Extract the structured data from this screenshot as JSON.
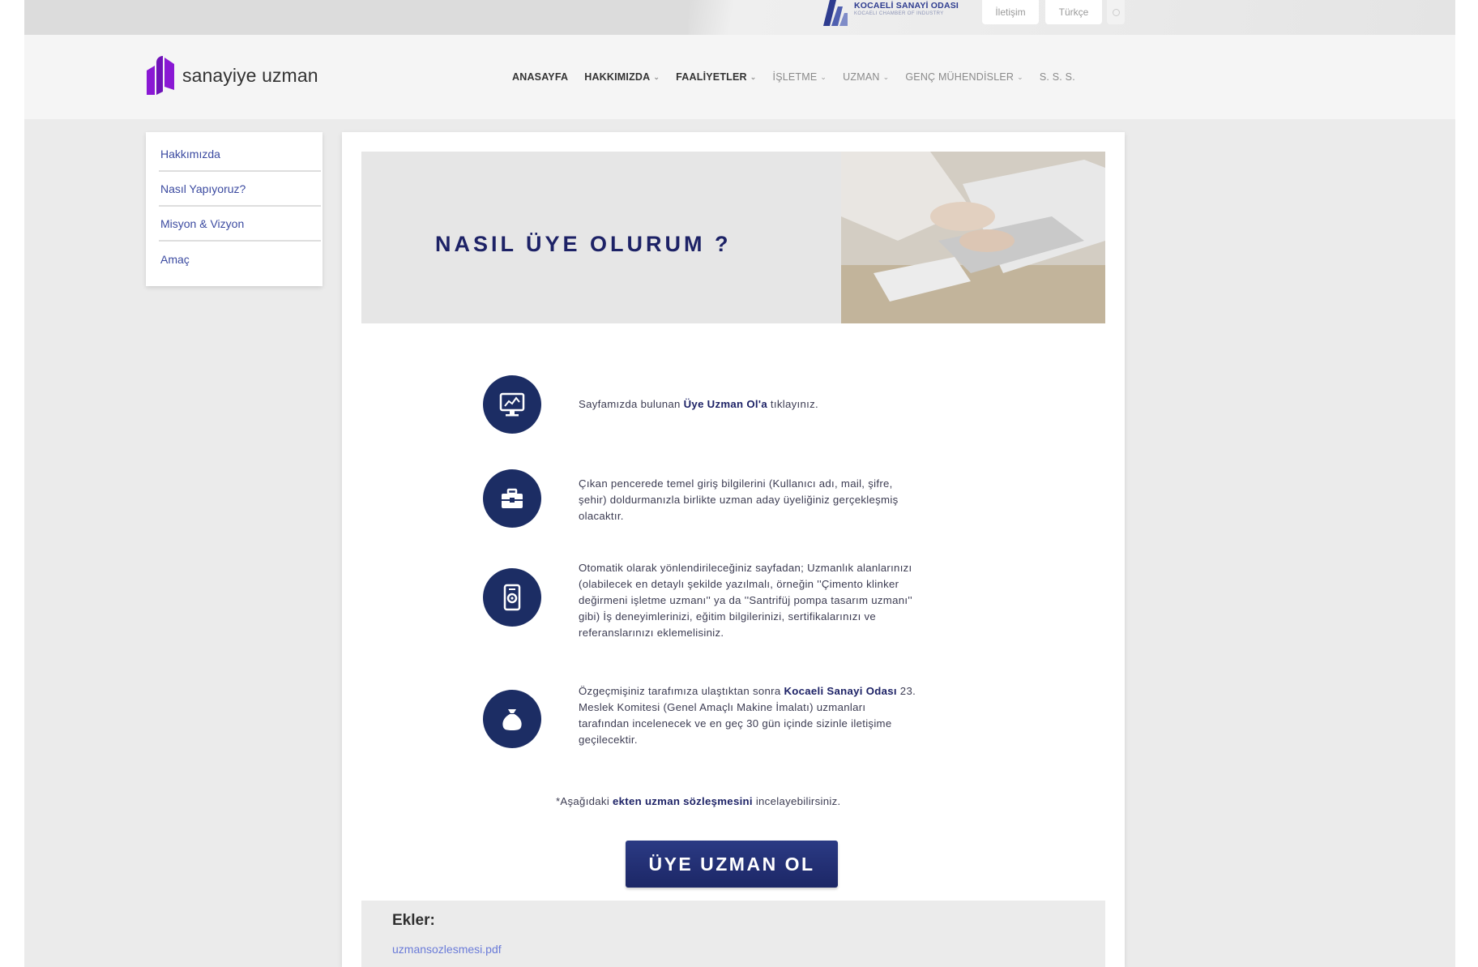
{
  "topbar": {
    "chamber_name": "KOCAELİ SANAYİ ODASI",
    "chamber_subtitle": "KOCAELI CHAMBER OF INDUSTRY",
    "contact_label": "İletişim",
    "language_label": "Türkçe"
  },
  "header": {
    "brand_name": "sanayiye uzman",
    "nav": [
      {
        "label": "ANASAYFA"
      },
      {
        "label": "HAKKIMIZDA"
      },
      {
        "label": "FAALİYETLER"
      },
      {
        "label": "İŞLETME"
      },
      {
        "label": "UZMAN"
      },
      {
        "label": "GENÇ MÜHENDİSLER"
      },
      {
        "label": "S. S. S."
      }
    ]
  },
  "sidebar": {
    "items": [
      {
        "label": "Hakkımızda"
      },
      {
        "label": "Nasıl Yapıyoruz?"
      },
      {
        "label": "Misyon & Vizyon"
      },
      {
        "label": "Amaç"
      }
    ]
  },
  "hero": {
    "title": "NASIL ÜYE OLURUM ?"
  },
  "steps": [
    {
      "icon": "monitor-chart-icon",
      "parts": [
        "Sayfamızda bulunan ",
        "Üye Uzman Ol'a",
        " tıklayınız."
      ]
    },
    {
      "icon": "briefcase-icon",
      "text": "Çıkan pencerede temel giriş bilgilerini (Kullanıcı adı, mail, şifre, şehir) doldurmanızla birlikte uzman aday üyeliğiniz gerçekleşmiş olacaktır."
    },
    {
      "icon": "mobile-gear-icon",
      "text": "Otomatik olarak yönlendirileceğiniz sayfadan; Uzmanlık alanlarınızı (olabilecek en detaylı şekilde yazılmalı, örneğin ''Çimento klinker değirmeni işletme uzmanı'' ya da ''Santrifüj pompa tasarım uzmanı'' gibi) İş deneyimlerinizi, eğitim bilgilerinizi, sertifikalarınızı ve referanslarınızı eklemelisiniz."
    },
    {
      "icon": "money-bag-icon",
      "parts": [
        "Özgeçmişiniz tarafımıza ulaştıktan sonra ",
        "Kocaeli Sanayi Odası",
        " 23. Meslek Komitesi (Genel Amaçlı Makine İmalatı) uzmanları tarafından incelenecek ve en geç 30 gün içinde sizinle iletişime geçilecektir."
      ]
    }
  ],
  "note": {
    "parts": [
      "*Aşağıdaki ",
      "ekten",
      " ",
      "uzman sözleşmesini",
      "  incelayebilirsiniz."
    ]
  },
  "cta": {
    "label": "ÜYE UZMAN OL"
  },
  "attachments": {
    "label": "Ekler:",
    "file": "uzmansozlesmesi.pdf"
  },
  "colors": {
    "brand_purple": "#8a18d4",
    "navy": "#1c2d64",
    "link": "#6a7bd8",
    "chamber_blue": "#2e3c8f"
  }
}
